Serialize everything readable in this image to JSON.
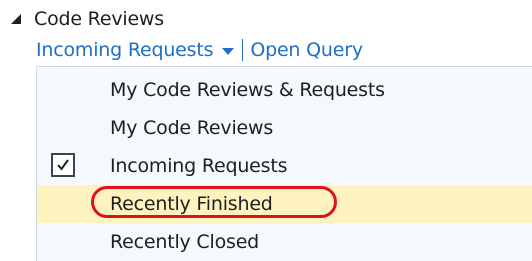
{
  "section": {
    "title": "Code Reviews",
    "collapse_icon": "triangle-down-icon"
  },
  "toolbar": {
    "current_query_label": "Incoming Requests",
    "open_query_label": "Open Query",
    "link_color": "#1e6fc7"
  },
  "menu": {
    "items": [
      {
        "label": "My Code Reviews & Requests",
        "checked": false,
        "highlighted": false
      },
      {
        "label": "My Code Reviews",
        "checked": false,
        "highlighted": false
      },
      {
        "label": "Incoming Requests",
        "checked": true,
        "highlighted": false
      },
      {
        "label": "Recently Finished",
        "checked": false,
        "highlighted": true,
        "annotated": true
      },
      {
        "label": "Recently Closed",
        "checked": false,
        "highlighted": false
      }
    ],
    "highlight_color": "#fdf3bf",
    "annotation_color": "#e0101c"
  }
}
